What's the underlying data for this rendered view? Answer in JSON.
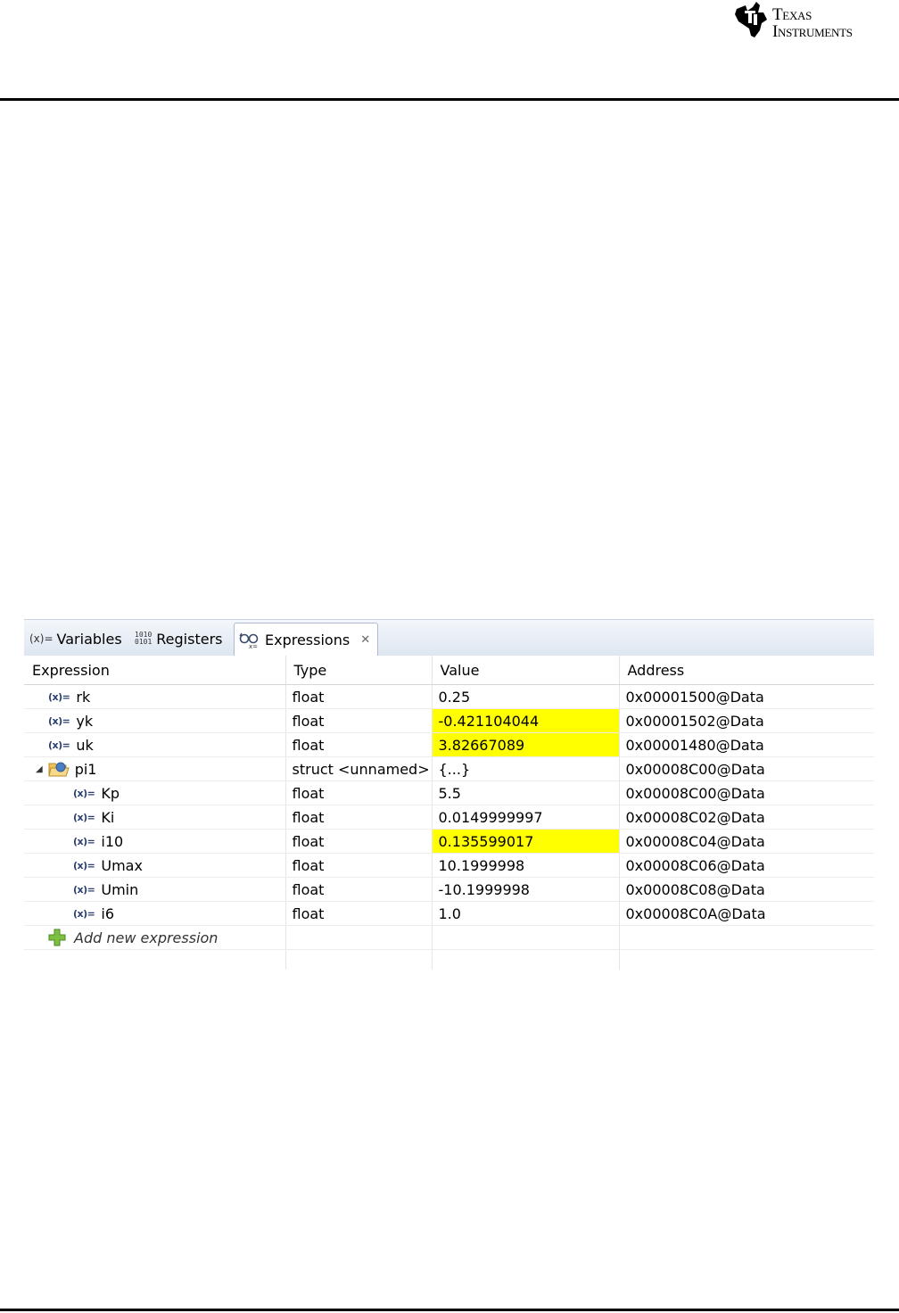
{
  "brand": {
    "line1": "Texas",
    "line2": "Instruments"
  },
  "colors": {
    "highlight": "#ffff00",
    "tab_bar": "#dde6f1"
  },
  "tabs": [
    {
      "icon": "(x)=",
      "label": "Variables"
    },
    {
      "icon": "1010 0101",
      "label": "Registers"
    },
    {
      "icon": "expressions-icon",
      "label": "Expressions",
      "active": true
    }
  ],
  "columns": [
    "Expression",
    "Type",
    "Value",
    "Address"
  ],
  "rows": [
    {
      "name": "rk",
      "type": "float",
      "value": "0.25",
      "address": "0x00001500@Data"
    },
    {
      "name": "yk",
      "type": "float",
      "value": "-0.421104044",
      "address": "0x00001502@Data"
    },
    {
      "name": "uk",
      "type": "float",
      "value": "3.82667089",
      "address": "0x00001480@Data"
    },
    {
      "name": "pi1",
      "type": "struct <unnamed>",
      "value": "{...}",
      "address": "0x00008C00@Data"
    },
    {
      "name": "Kp",
      "type": "float",
      "value": "5.5",
      "address": "0x00008C00@Data"
    },
    {
      "name": "Ki",
      "type": "float",
      "value": "0.0149999997",
      "address": "0x00008C02@Data"
    },
    {
      "name": "i10",
      "type": "float",
      "value": "0.135599017",
      "address": "0x00008C04@Data"
    },
    {
      "name": "Umax",
      "type": "float",
      "value": "10.1999998",
      "address": "0x00008C06@Data"
    },
    {
      "name": "Umin",
      "type": "float",
      "value": "-10.1999998",
      "address": "0x00008C08@Data"
    },
    {
      "name": "i6",
      "type": "float",
      "value": "1.0",
      "address": "0x00008C0A@Data"
    }
  ],
  "add_expression_label": "Add new expression",
  "var_icon_text": "(x)="
}
